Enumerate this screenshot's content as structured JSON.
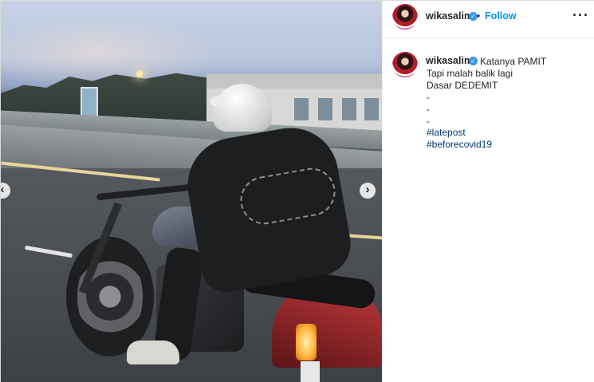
{
  "post": {
    "username": "wikasalim",
    "verified_icon": "verified-badge-icon",
    "separator": "•",
    "follow_label": "Follow",
    "more_icon": "more-options-icon",
    "more_glyph": "···"
  },
  "caption": {
    "username": "wikasalim",
    "first_line": "Katanya PAMIT",
    "lines": [
      "Tapi malah balik lagi",
      "Dasar DEDEMIT",
      "-",
      "-",
      "-"
    ],
    "hashtags": [
      "#latepost",
      "#beforecovid19"
    ]
  },
  "carousel": {
    "prev_glyph": "‹",
    "next_glyph": "›"
  },
  "colors": {
    "accent": "#0095f6",
    "verified": "#3897f0",
    "hashtag": "#00376b"
  }
}
